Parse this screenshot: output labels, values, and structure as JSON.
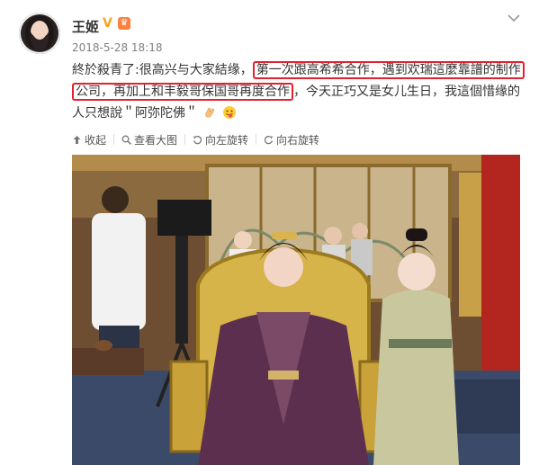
{
  "post": {
    "username": "王姬",
    "vip_icon": "verified-v-icon",
    "badge_icon": "member-badge-icon",
    "timestamp": "2018-5-28 18:18",
    "text": {
      "line1_a": "終於殺青了:很高兴与大家結缘，",
      "line1_hl": "第一次跟高希希合作，遇到欢瑞這麼靠譜的制作",
      "line2_hl": "公司，再加上和丰毅哥保国哥再度合作",
      "line2_b": "，今天正巧又是女儿生日，我這個惜缘的",
      "line3": "人只想說＂阿弥陀佛＂"
    },
    "emojis": [
      "clap-hands-icon",
      "tongue-face-icon"
    ],
    "highlight_color": "#e5212f"
  },
  "actions": {
    "collapse": "收起",
    "view_large": "查看大图",
    "rotate_left": "向左旋转",
    "rotate_right": "向右旋转"
  }
}
